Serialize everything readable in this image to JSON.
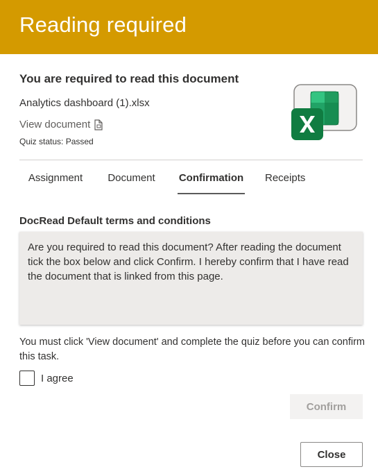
{
  "header": {
    "title": "Reading required"
  },
  "document": {
    "heading": "You are required to read this document",
    "file_name": "Analytics dashboard (1).xlsx",
    "view_link": "View document",
    "quiz_status": "Quiz status: Passed",
    "icon": "excel-file-icon"
  },
  "tabs": [
    {
      "label": "Assignment",
      "active": false
    },
    {
      "label": "Document",
      "active": false
    },
    {
      "label": "Confirmation",
      "active": true
    },
    {
      "label": "Receipts",
      "active": false
    }
  ],
  "confirmation": {
    "terms_title": "DocRead Default terms and conditions",
    "terms_text": "Are you required to read this document? After reading the document tick the box below and click Confirm. I hereby confirm that I have read the document that is linked from this page.",
    "notice": "You must click 'View document' and complete the quiz before you can confirm this task.",
    "agree_label": "I agree",
    "agree_checked": false,
    "confirm_label": "Confirm",
    "confirm_enabled": false
  },
  "footer": {
    "close_label": "Close"
  },
  "colors": {
    "header_bg": "#d49a00",
    "excel_green": "#107c41"
  }
}
